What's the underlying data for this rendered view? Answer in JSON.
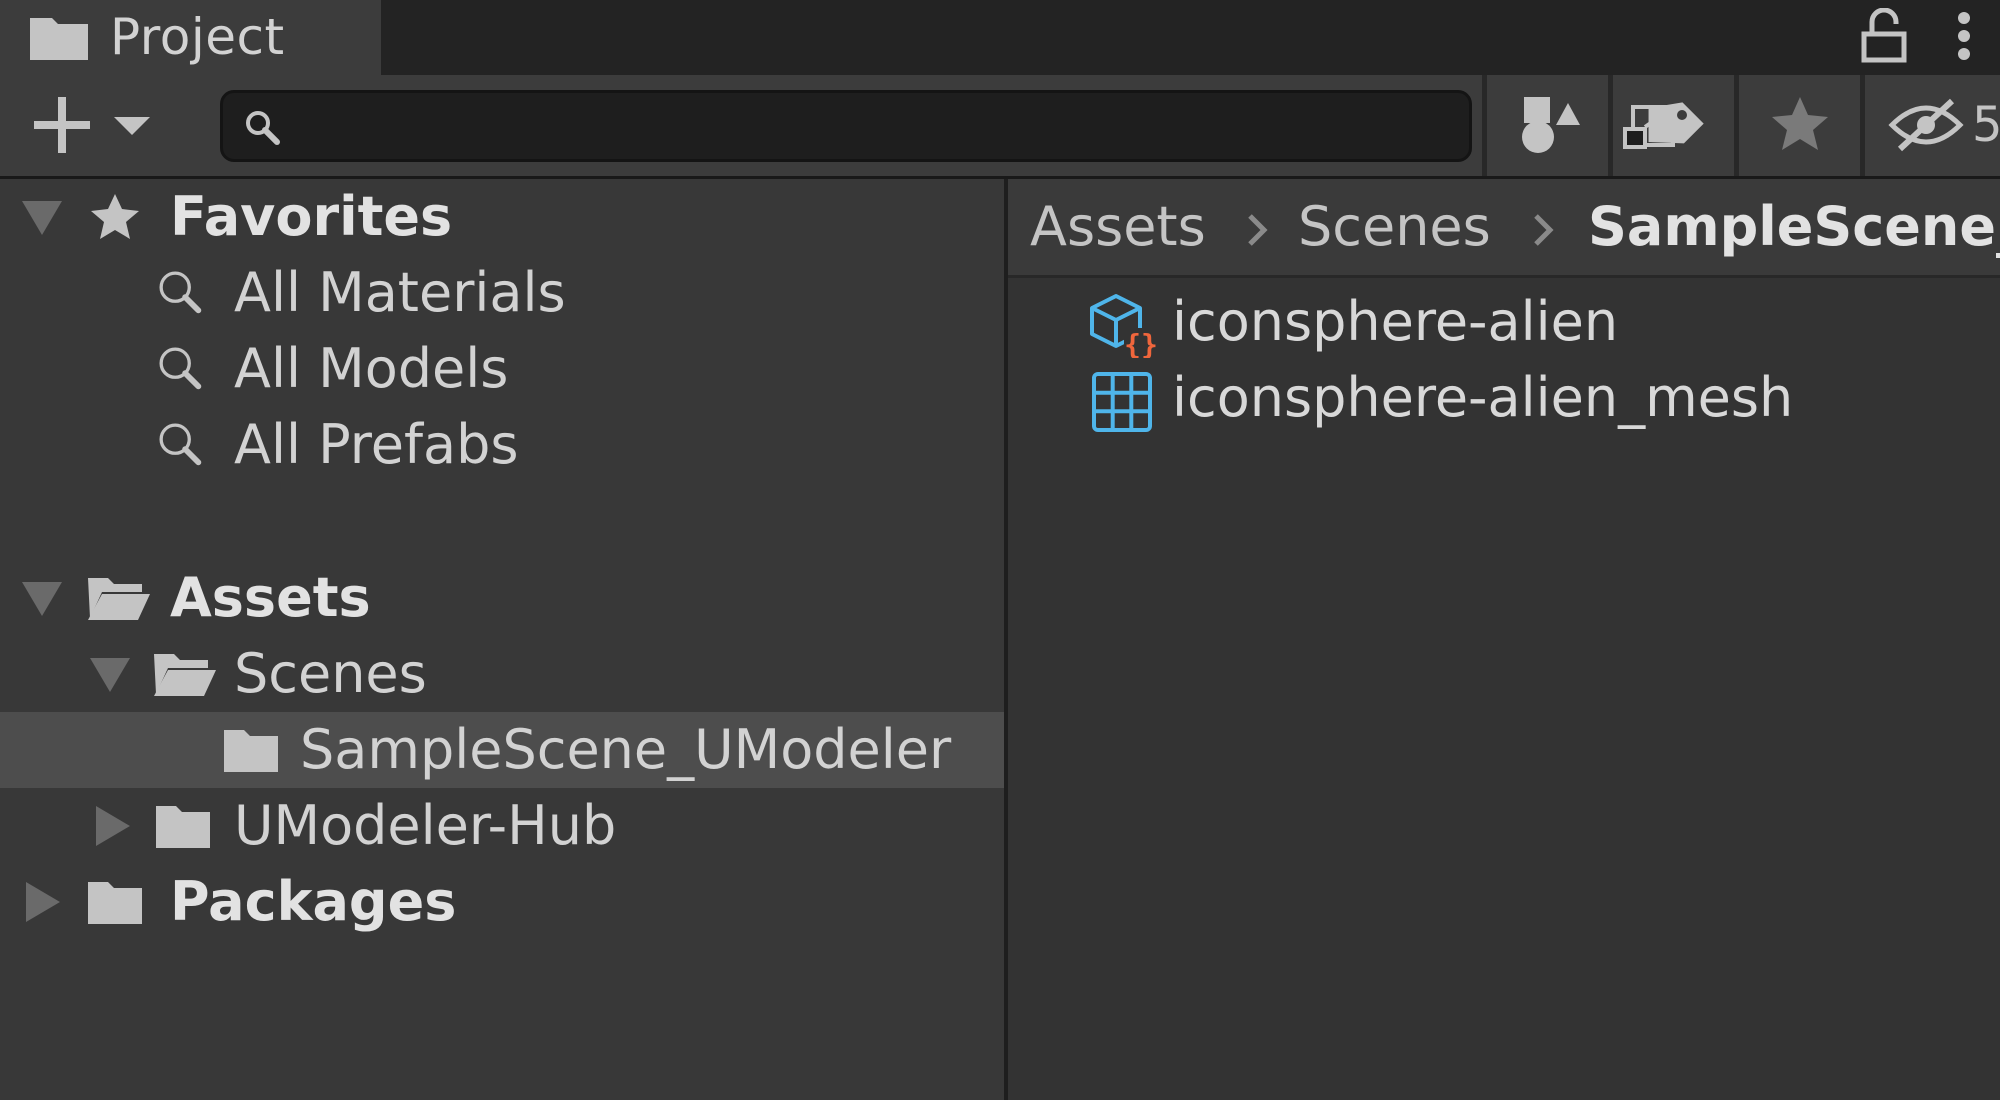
{
  "window": {
    "tab_label": "Project",
    "tab_icon": "folder-icon",
    "lock_icon": "lock-open-icon",
    "menu_icon": "kebab-menu-icon"
  },
  "toolbar": {
    "create_icon": "plus-icon",
    "create_dropdown_icon": "caret-down-icon",
    "search": {
      "value": "",
      "placeholder": "",
      "icon": "search-icon"
    },
    "popout_icon": "open-in-window-icon",
    "buttons": [
      {
        "name": "search-by-type",
        "icon": "shapes-icon"
      },
      {
        "name": "search-by-label",
        "icon": "tag-icon"
      },
      {
        "name": "save-search",
        "icon": "star-icon"
      },
      {
        "name": "hidden-packages",
        "icon": "eye-slash-icon",
        "count": "5"
      }
    ]
  },
  "tree": {
    "favorites": {
      "label": "Favorites",
      "icon": "star-icon",
      "items": [
        {
          "label": "All Materials",
          "icon": "search-icon"
        },
        {
          "label": "All Models",
          "icon": "search-icon"
        },
        {
          "label": "All Prefabs",
          "icon": "search-icon"
        }
      ]
    },
    "assets": {
      "label": "Assets",
      "icon": "folder-open-icon",
      "children": [
        {
          "label": "Scenes",
          "icon": "folder-open-icon",
          "children": [
            {
              "label": "SampleScene_UModeler",
              "icon": "folder-icon",
              "selected": true
            }
          ]
        },
        {
          "label": "UModeler-Hub",
          "icon": "folder-icon"
        }
      ]
    },
    "packages": {
      "label": "Packages",
      "icon": "folder-icon"
    }
  },
  "breadcrumb": [
    "Assets",
    "Scenes",
    "SampleScene_"
  ],
  "files": [
    {
      "label": "iconsphere-alien",
      "icon": "model-prefab-icon"
    },
    {
      "label": "iconsphere-alien_mesh",
      "icon": "mesh-grid-icon"
    }
  ],
  "colors": {
    "background": "#282828",
    "panel": "#383838",
    "panel_dark": "#333333",
    "selection": "#4d4d4d",
    "text": "#d2d2d2",
    "icon_gray": "#c4c4c4",
    "asset_blue": "#4fb5ea",
    "asset_orange": "#f0663c"
  }
}
